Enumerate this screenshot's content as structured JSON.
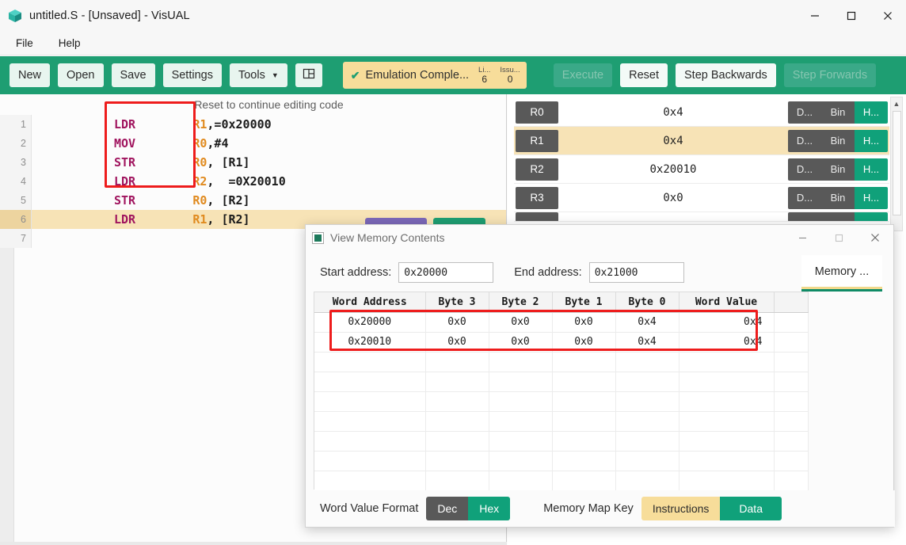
{
  "window": {
    "title": "untitled.S - [Unsaved] - VisUAL",
    "app_icon": "cube-icon",
    "controls": {
      "minimize": "minimize-icon",
      "maximize": "maximize-icon",
      "close": "close-icon"
    }
  },
  "menubar": {
    "items": [
      "File",
      "Help"
    ]
  },
  "toolbar": {
    "buttons": [
      {
        "label": "New",
        "name": "new-button",
        "disabled": false
      },
      {
        "label": "Open",
        "name": "open-button",
        "disabled": false
      },
      {
        "label": "Save",
        "name": "save-button",
        "disabled": false
      },
      {
        "label": "Settings",
        "name": "settings-button",
        "disabled": false
      },
      {
        "label": "Tools",
        "name": "tools-button",
        "disabled": false,
        "caret": true
      }
    ],
    "panel_icon": "split-panel-icon",
    "status": {
      "check": "✔",
      "text": "Emulation Comple...",
      "stats": [
        {
          "key": "Li...",
          "value": "6"
        },
        {
          "key": "Issu...",
          "value": "0"
        }
      ]
    },
    "run_buttons": [
      {
        "label": "Execute",
        "name": "execute-button",
        "disabled": true
      },
      {
        "label": "Reset",
        "name": "reset-button",
        "disabled": false
      },
      {
        "label": "Step Backwards",
        "name": "step-backwards-button",
        "disabled": false
      },
      {
        "label": "Step Forwards",
        "name": "step-forwards-button",
        "disabled": true
      }
    ]
  },
  "editor": {
    "banner": "Reset to continue editing code",
    "lines": [
      {
        "num": "1",
        "mnemonic": "LDR",
        "operands_reg": "R1",
        "operands_rest": ",=0x20000",
        "active": false
      },
      {
        "num": "2",
        "mnemonic": "MOV",
        "operands_reg": "R0",
        "operands_rest": ",#4",
        "active": false
      },
      {
        "num": "3",
        "mnemonic": "STR",
        "operands_reg": "R0",
        "operands_rest": ", [R1]",
        "active": false
      },
      {
        "num": "4",
        "mnemonic": "LDR",
        "operands_reg": "R2",
        "operands_rest": ",  =0X20010",
        "active": false
      },
      {
        "num": "5",
        "mnemonic": "STR",
        "operands_reg": "R0",
        "operands_rest": ", [R2]",
        "active": false
      },
      {
        "num": "6",
        "mnemonic": "LDR",
        "operands_reg": "R1",
        "operands_rest": ", [R2]",
        "active": true
      },
      {
        "num": "7",
        "mnemonic": "",
        "operands_reg": "",
        "operands_rest": "",
        "active": false
      }
    ]
  },
  "registers": {
    "format_buttons": [
      "D...",
      "Bin",
      "H..."
    ],
    "active_format": "H...",
    "rows": [
      {
        "name": "R0",
        "value": "0x4",
        "highlight": false
      },
      {
        "name": "R1",
        "value": "0x4",
        "highlight": true
      },
      {
        "name": "R2",
        "value": "0x20010",
        "highlight": false
      },
      {
        "name": "R3",
        "value": "0x0",
        "highlight": false
      }
    ]
  },
  "dialog": {
    "title": "View Memory Contents",
    "icon": "memory-window-icon",
    "controls": {
      "minimize": "minimize-icon",
      "maximize": "maximize-icon",
      "close": "close-icon"
    },
    "start_label": "Start address:",
    "start_value": "0x20000",
    "end_label": "End address:",
    "end_value": "0x21000",
    "tab": "Memory ...",
    "table": {
      "columns": [
        "Word Address",
        "Byte 3",
        "Byte 2",
        "Byte 1",
        "Byte 0",
        "Word Value"
      ],
      "rows": [
        [
          "0x20000",
          "0x0",
          "0x0",
          "0x0",
          "0x4",
          "0x4"
        ],
        [
          "0x20010",
          "0x0",
          "0x0",
          "0x0",
          "0x4",
          "0x4"
        ]
      ],
      "empty_row_count": 8
    },
    "footer": {
      "word_format_label": "Word Value Format",
      "word_format_options": [
        "Dec",
        "Hex"
      ],
      "word_format_active": "Hex",
      "map_key_label": "Memory Map Key",
      "map_key_instructions": "Instructions",
      "map_key_data": "Data"
    }
  },
  "colors": {
    "toolbar_green": "#1e9e72",
    "accent_green": "#10a17a",
    "highlight_yellow": "#f7e3b6",
    "badge_yellow": "#f7dd9a",
    "annotation_red": "#ee1c1c",
    "mnemonic_magenta": "#a0145e",
    "register_orange": "#e08a1e",
    "button_gray": "#595959"
  }
}
